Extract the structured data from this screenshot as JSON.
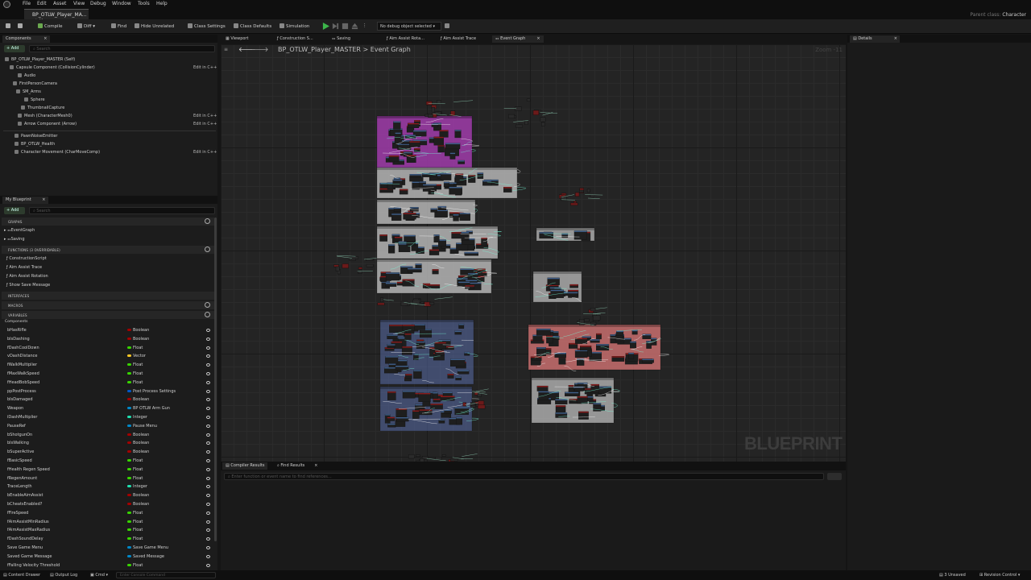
{
  "menu": {
    "items": [
      "File",
      "Edit",
      "Asset",
      "View",
      "Debug",
      "Window",
      "Tools",
      "Help"
    ]
  },
  "document_tab": {
    "label": "BP_OTLW_Player_MA...",
    "modified_mark": "• ×"
  },
  "parent_class": {
    "label": "Parent class:",
    "value": "Character"
  },
  "toolbar": {
    "compile": "Compile",
    "diff": "Diff",
    "find": "Find",
    "hide_unrelated": "Hide Unrelated",
    "class_settings": "Class Settings",
    "class_defaults": "Class Defaults",
    "simulation": "Simulation",
    "debug_object": "No debug object selected"
  },
  "components": {
    "tab": "Components",
    "add": "+ Add",
    "search_placeholder": "Search",
    "root": "BP_OTLW_Player_MASTER (Self)",
    "edit_cpp": "Edit in C++",
    "tree": [
      {
        "label": "Capsule Component (CollisionCylinder)",
        "edit": true
      },
      {
        "label": "Audio",
        "edit": false
      },
      {
        "label": "FirstPersonCamera",
        "edit": false
      },
      {
        "label": "SM_Arms",
        "edit": false
      },
      {
        "label": "Sphere",
        "edit": false
      },
      {
        "label": "ThumbnailCapture",
        "edit": false
      },
      {
        "label": "Mesh (CharacterMesh0)",
        "edit": true
      },
      {
        "label": "Arrow Component (Arrow)",
        "edit": true
      },
      {
        "label": "PawnNoiseEmitter",
        "edit": false
      },
      {
        "label": "BP_OTLW_Health",
        "edit": false
      },
      {
        "label": "Character Movement (CharMoveComp)",
        "edit": true
      }
    ]
  },
  "my_blueprint": {
    "tab": "My Blueprint",
    "add": "+ Add",
    "search_placeholder": "Search",
    "sections": {
      "graphs": "GRAPHS",
      "functions": "FUNCTIONS (3 OVERRIDABLE)",
      "macros": "MACROS",
      "interfaces": "INTERFACES",
      "variables": "VARIABLES",
      "components": "Components"
    },
    "graphs": [
      "EventGraph",
      "Saving"
    ],
    "functions": [
      "ConstructionScript",
      "Aim Assist Trace",
      "Aim Assist Rotation",
      "Show Save Message"
    ],
    "variables": [
      {
        "name": "bHasRifle",
        "type": "Boolean",
        "color": "#a30000"
      },
      {
        "name": "bIsDashing",
        "type": "Boolean",
        "color": "#a30000"
      },
      {
        "name": "fDashCoolDown",
        "type": "Float",
        "color": "#38d500"
      },
      {
        "name": "vDashDistance",
        "type": "Vector",
        "color": "#fdc824"
      },
      {
        "name": "fWalkMultiplier",
        "type": "Float",
        "color": "#38d500"
      },
      {
        "name": "fMaxWalkSpeed",
        "type": "Float",
        "color": "#38d500"
      },
      {
        "name": "fHeadBobSpeed",
        "type": "Float",
        "color": "#38d500"
      },
      {
        "name": "ppPostProcess",
        "type": "Post Process Settings",
        "color": "#0058c8"
      },
      {
        "name": "bIsDamaged",
        "type": "Boolean",
        "color": "#a30000"
      },
      {
        "name": "Weapon",
        "type": "BP OTLW Arm Gun",
        "color": "#0088c8"
      },
      {
        "name": "iDashMultiplier",
        "type": "Integer",
        "color": "#1fe0b0"
      },
      {
        "name": "PauseRef",
        "type": "Pause Menu",
        "color": "#0088c8"
      },
      {
        "name": "bShotgunOn",
        "type": "Boolean",
        "color": "#a30000"
      },
      {
        "name": "bIsWalking",
        "type": "Boolean",
        "color": "#a30000"
      },
      {
        "name": "bSuperActive",
        "type": "Boolean",
        "color": "#a30000"
      },
      {
        "name": "fBasicSpeed",
        "type": "Float",
        "color": "#38d500"
      },
      {
        "name": "fHealth Regen Speed",
        "type": "Float",
        "color": "#38d500"
      },
      {
        "name": "fRegenAmount",
        "type": "Float",
        "color": "#38d500"
      },
      {
        "name": "TraceLength",
        "type": "Integer",
        "color": "#1fe0b0"
      },
      {
        "name": "bEnableAimAssist",
        "type": "Boolean",
        "color": "#a30000"
      },
      {
        "name": "bCheatsEnabled?",
        "type": "Boolean",
        "color": "#a30000"
      },
      {
        "name": "fFireSpeed",
        "type": "Float",
        "color": "#38d500"
      },
      {
        "name": "fAimAssistMinRadius",
        "type": "Float",
        "color": "#38d500"
      },
      {
        "name": "fAimAssistMaxRadius",
        "type": "Float",
        "color": "#38d500"
      },
      {
        "name": "fDashSoundDelay",
        "type": "Float",
        "color": "#38d500"
      },
      {
        "name": "Save Game Menu",
        "type": "Save Game Menu",
        "color": "#0088c8"
      },
      {
        "name": "Saved Game Message",
        "type": "Saved Message",
        "color": "#0088c8"
      },
      {
        "name": "fFalling Velocity Threshold",
        "type": "Float",
        "color": "#38d500"
      }
    ]
  },
  "graph_tabs": [
    "Viewport",
    "Construction S...",
    "Saving",
    "Aim Assist Rota...",
    "Aim Assist Trace",
    "Event Graph"
  ],
  "breadcrumb": {
    "blueprint": "BP_OTLW_Player_MASTER",
    "sep": ">",
    "graph": "Event Graph"
  },
  "zoom": "Zoom -11",
  "watermark": "BLUEPRINT",
  "details": {
    "tab": "Details"
  },
  "bottom": {
    "tabs": [
      "Compiler Results",
      "Find Results"
    ],
    "find_placeholder": "Enter function or event name to find references..."
  },
  "status": {
    "content_drawer": "Content Drawer",
    "output_log": "Output Log",
    "cmd": "Cmd",
    "console_placeholder": "Enter Console Command",
    "unsaved": "3 Unsaved",
    "revision": "Revision Control"
  }
}
